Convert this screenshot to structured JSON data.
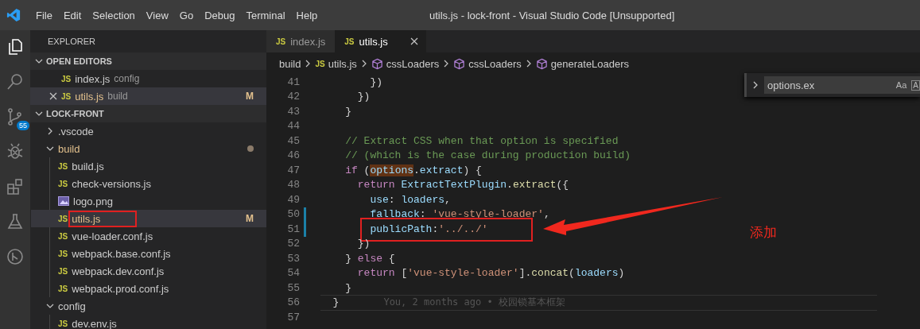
{
  "window": {
    "title": "utils.js - lock-front - Visual Studio Code [Unsupported]"
  },
  "menu": [
    {
      "label": "File"
    },
    {
      "label": "Edit"
    },
    {
      "label": "Selection"
    },
    {
      "label": "View"
    },
    {
      "label": "Go"
    },
    {
      "label": "Debug"
    },
    {
      "label": "Terminal"
    },
    {
      "label": "Help"
    }
  ],
  "activity_bar": [
    {
      "kind": "files",
      "selected": true
    },
    {
      "kind": "search",
      "selected": false
    },
    {
      "kind": "source-control",
      "selected": false,
      "badge": "55"
    },
    {
      "kind": "debug",
      "selected": false
    },
    {
      "kind": "extensions",
      "selected": false
    },
    {
      "kind": "test",
      "selected": false
    },
    {
      "kind": "graph",
      "selected": false
    }
  ],
  "sidebar": {
    "title": "EXPLORER",
    "open_editors": {
      "title": "OPEN EDITORS",
      "expanded": true,
      "items": [
        {
          "icon_text": "JS",
          "label": "index.js",
          "description": "config",
          "selected": false
        },
        {
          "icon_text": "JS",
          "label": "utils.js",
          "description": "build",
          "selected": true,
          "status": "M"
        }
      ]
    },
    "project": {
      "title": "LOCK-FRONT",
      "expanded": true,
      "items": [
        {
          "kind": "folder",
          "label": ".vscode",
          "expanded": false
        },
        {
          "kind": "folder",
          "label": "build",
          "expanded": true,
          "modified_dot": true,
          "children": [
            {
              "kind": "file",
              "icon_text": "JS",
              "label": "build.js",
              "selected": false
            },
            {
              "kind": "file",
              "icon_text": "JS",
              "label": "check-versions.js",
              "selected": false
            },
            {
              "kind": "file",
              "label": "logo.png",
              "selected": false
            },
            {
              "kind": "file",
              "icon_text": "JS",
              "label": "utils.js",
              "selected": true,
              "status": "M",
              "boxed": true
            },
            {
              "kind": "file",
              "icon_text": "JS",
              "label": "vue-loader.conf.js",
              "selected": false
            },
            {
              "kind": "file",
              "icon_text": "JS",
              "label": "webpack.base.conf.js",
              "selected": false
            },
            {
              "kind": "file",
              "icon_text": "JS",
              "label": "webpack.dev.conf.js",
              "selected": false
            },
            {
              "kind": "file",
              "icon_text": "JS",
              "label": "webpack.prod.conf.js",
              "selected": false
            }
          ]
        },
        {
          "kind": "folder",
          "label": "config",
          "expanded": true,
          "children": [
            {
              "kind": "file",
              "icon_text": "JS",
              "label": "dev.env.js",
              "selected": false
            }
          ]
        }
      ]
    }
  },
  "tabs": [
    {
      "icon_text": "JS",
      "label": "index.js",
      "selected": false
    },
    {
      "icon_text": "JS",
      "label": "utils.js",
      "selected": true
    }
  ],
  "breadcrumbs": [
    {
      "kind": "folder",
      "label": "build"
    },
    {
      "kind": "js",
      "icon_text": "JS",
      "label": "utils.js"
    },
    {
      "kind": "symbol",
      "label": "cssLoaders"
    },
    {
      "kind": "symbol",
      "label": "cssLoaders"
    },
    {
      "kind": "symbol",
      "label": "generateLoaders"
    }
  ],
  "find_widget": {
    "value": "options.ex",
    "options": [
      "Aa",
      "A"
    ]
  },
  "code": [
    {
      "number": "41",
      "modified": false,
      "tokens": [
        {
          "kind": "punc",
          "text": "        })"
        }
      ]
    },
    {
      "number": "42",
      "modified": false,
      "tokens": [
        {
          "kind": "punc",
          "text": "      })"
        }
      ]
    },
    {
      "number": "43",
      "modified": false,
      "tokens": [
        {
          "kind": "punc",
          "text": "    }"
        }
      ]
    },
    {
      "number": "44",
      "modified": false
    },
    {
      "number": "45",
      "modified": false,
      "tokens": [
        {
          "kind": "cmt",
          "text": "    // Extract CSS when that option is specified"
        }
      ]
    },
    {
      "number": "46",
      "modified": false,
      "tokens": [
        {
          "kind": "cmt",
          "text": "    // (which is the case during production build)"
        }
      ]
    },
    {
      "number": "47",
      "modified": false,
      "tokens": [
        {
          "kind": "kw",
          "text": "    if"
        },
        {
          "kind": "punc",
          "text": " ("
        },
        {
          "kind": "match",
          "text": "options"
        },
        {
          "kind": "punc",
          "text": "."
        },
        {
          "kind": "var",
          "text": "extract"
        },
        {
          "kind": "punc",
          "text": ") {"
        }
      ]
    },
    {
      "number": "48",
      "modified": false,
      "tokens": [
        {
          "kind": "kw",
          "text": "      return"
        },
        {
          "kind": "var",
          "text": " ExtractTextPlugin"
        },
        {
          "kind": "punc",
          "text": "."
        },
        {
          "kind": "fn",
          "text": "extract"
        },
        {
          "kind": "punc",
          "text": "({"
        }
      ]
    },
    {
      "number": "49",
      "modified": false,
      "tokens": [
        {
          "kind": "var",
          "text": "        use"
        },
        {
          "kind": "punc",
          "text": ": "
        },
        {
          "kind": "var",
          "text": "loaders"
        },
        {
          "kind": "punc",
          "text": ","
        }
      ]
    },
    {
      "number": "50",
      "modified": true,
      "tokens": [
        {
          "kind": "var",
          "text": "        fallback"
        },
        {
          "kind": "punc",
          "text": ": "
        },
        {
          "kind": "str",
          "text": "'vue-style-loader'"
        },
        {
          "kind": "punc",
          "text": ","
        }
      ]
    },
    {
      "number": "51",
      "modified": true,
      "boxed": true,
      "tokens": [
        {
          "kind": "var",
          "text": "        publicPath"
        },
        {
          "kind": "punc",
          "text": ":"
        },
        {
          "kind": "str",
          "text": "'../../'"
        }
      ]
    },
    {
      "number": "52",
      "modified": false,
      "tokens": [
        {
          "kind": "punc",
          "text": "      })"
        }
      ]
    },
    {
      "number": "53",
      "modified": false,
      "tokens": [
        {
          "kind": "punc",
          "text": "    } "
        },
        {
          "kind": "kw",
          "text": "else"
        },
        {
          "kind": "punc",
          "text": " {"
        }
      ]
    },
    {
      "number": "54",
      "modified": false,
      "tokens": [
        {
          "kind": "kw",
          "text": "      return"
        },
        {
          "kind": "punc",
          "text": " ["
        },
        {
          "kind": "str",
          "text": "'vue-style-loader'"
        },
        {
          "kind": "punc",
          "text": "]."
        },
        {
          "kind": "fn",
          "text": "concat"
        },
        {
          "kind": "punc",
          "text": "("
        },
        {
          "kind": "var",
          "text": "loaders"
        },
        {
          "kind": "punc",
          "text": ")"
        }
      ]
    },
    {
      "number": "55",
      "modified": false,
      "tokens": [
        {
          "kind": "punc",
          "text": "    }"
        }
      ]
    },
    {
      "number": "56",
      "modified": false,
      "current": true,
      "blame": "You, 2 months ago • 校园锁基本框架",
      "tokens": [
        {
          "kind": "punc",
          "text": "  }"
        }
      ]
    },
    {
      "number": "57",
      "modified": false
    }
  ],
  "annotation": {
    "label": "添加"
  }
}
